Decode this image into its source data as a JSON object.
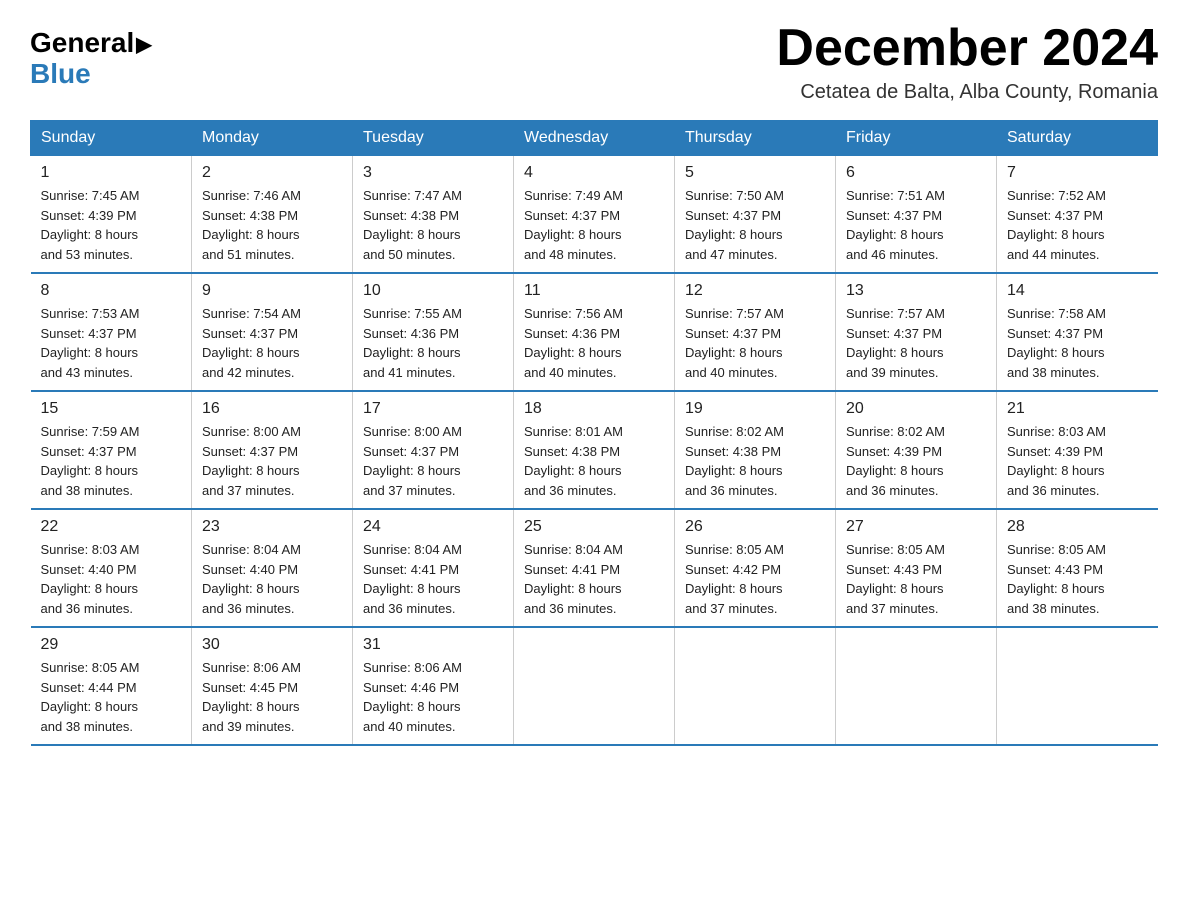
{
  "logo": {
    "general": "General",
    "blue": "Blue"
  },
  "title": "December 2024",
  "location": "Cetatea de Balta, Alba County, Romania",
  "weekdays": [
    "Sunday",
    "Monday",
    "Tuesday",
    "Wednesday",
    "Thursday",
    "Friday",
    "Saturday"
  ],
  "weeks": [
    [
      {
        "day": "1",
        "sunrise": "7:45 AM",
        "sunset": "4:39 PM",
        "daylight": "8 hours and 53 minutes."
      },
      {
        "day": "2",
        "sunrise": "7:46 AM",
        "sunset": "4:38 PM",
        "daylight": "8 hours and 51 minutes."
      },
      {
        "day": "3",
        "sunrise": "7:47 AM",
        "sunset": "4:38 PM",
        "daylight": "8 hours and 50 minutes."
      },
      {
        "day": "4",
        "sunrise": "7:49 AM",
        "sunset": "4:37 PM",
        "daylight": "8 hours and 48 minutes."
      },
      {
        "day": "5",
        "sunrise": "7:50 AM",
        "sunset": "4:37 PM",
        "daylight": "8 hours and 47 minutes."
      },
      {
        "day": "6",
        "sunrise": "7:51 AM",
        "sunset": "4:37 PM",
        "daylight": "8 hours and 46 minutes."
      },
      {
        "day": "7",
        "sunrise": "7:52 AM",
        "sunset": "4:37 PM",
        "daylight": "8 hours and 44 minutes."
      }
    ],
    [
      {
        "day": "8",
        "sunrise": "7:53 AM",
        "sunset": "4:37 PM",
        "daylight": "8 hours and 43 minutes."
      },
      {
        "day": "9",
        "sunrise": "7:54 AM",
        "sunset": "4:37 PM",
        "daylight": "8 hours and 42 minutes."
      },
      {
        "day": "10",
        "sunrise": "7:55 AM",
        "sunset": "4:36 PM",
        "daylight": "8 hours and 41 minutes."
      },
      {
        "day": "11",
        "sunrise": "7:56 AM",
        "sunset": "4:36 PM",
        "daylight": "8 hours and 40 minutes."
      },
      {
        "day": "12",
        "sunrise": "7:57 AM",
        "sunset": "4:37 PM",
        "daylight": "8 hours and 40 minutes."
      },
      {
        "day": "13",
        "sunrise": "7:57 AM",
        "sunset": "4:37 PM",
        "daylight": "8 hours and 39 minutes."
      },
      {
        "day": "14",
        "sunrise": "7:58 AM",
        "sunset": "4:37 PM",
        "daylight": "8 hours and 38 minutes."
      }
    ],
    [
      {
        "day": "15",
        "sunrise": "7:59 AM",
        "sunset": "4:37 PM",
        "daylight": "8 hours and 38 minutes."
      },
      {
        "day": "16",
        "sunrise": "8:00 AM",
        "sunset": "4:37 PM",
        "daylight": "8 hours and 37 minutes."
      },
      {
        "day": "17",
        "sunrise": "8:00 AM",
        "sunset": "4:37 PM",
        "daylight": "8 hours and 37 minutes."
      },
      {
        "day": "18",
        "sunrise": "8:01 AM",
        "sunset": "4:38 PM",
        "daylight": "8 hours and 36 minutes."
      },
      {
        "day": "19",
        "sunrise": "8:02 AM",
        "sunset": "4:38 PM",
        "daylight": "8 hours and 36 minutes."
      },
      {
        "day": "20",
        "sunrise": "8:02 AM",
        "sunset": "4:39 PM",
        "daylight": "8 hours and 36 minutes."
      },
      {
        "day": "21",
        "sunrise": "8:03 AM",
        "sunset": "4:39 PM",
        "daylight": "8 hours and 36 minutes."
      }
    ],
    [
      {
        "day": "22",
        "sunrise": "8:03 AM",
        "sunset": "4:40 PM",
        "daylight": "8 hours and 36 minutes."
      },
      {
        "day": "23",
        "sunrise": "8:04 AM",
        "sunset": "4:40 PM",
        "daylight": "8 hours and 36 minutes."
      },
      {
        "day": "24",
        "sunrise": "8:04 AM",
        "sunset": "4:41 PM",
        "daylight": "8 hours and 36 minutes."
      },
      {
        "day": "25",
        "sunrise": "8:04 AM",
        "sunset": "4:41 PM",
        "daylight": "8 hours and 36 minutes."
      },
      {
        "day": "26",
        "sunrise": "8:05 AM",
        "sunset": "4:42 PM",
        "daylight": "8 hours and 37 minutes."
      },
      {
        "day": "27",
        "sunrise": "8:05 AM",
        "sunset": "4:43 PM",
        "daylight": "8 hours and 37 minutes."
      },
      {
        "day": "28",
        "sunrise": "8:05 AM",
        "sunset": "4:43 PM",
        "daylight": "8 hours and 38 minutes."
      }
    ],
    [
      {
        "day": "29",
        "sunrise": "8:05 AM",
        "sunset": "4:44 PM",
        "daylight": "8 hours and 38 minutes."
      },
      {
        "day": "30",
        "sunrise": "8:06 AM",
        "sunset": "4:45 PM",
        "daylight": "8 hours and 39 minutes."
      },
      {
        "day": "31",
        "sunrise": "8:06 AM",
        "sunset": "4:46 PM",
        "daylight": "8 hours and 40 minutes."
      },
      null,
      null,
      null,
      null
    ]
  ]
}
